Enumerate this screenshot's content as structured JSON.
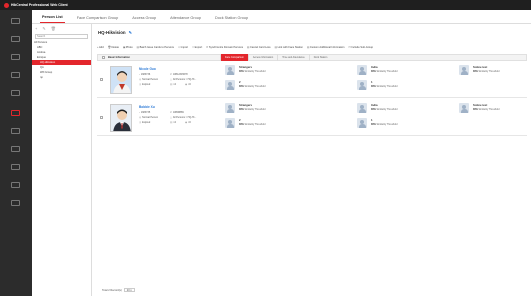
{
  "app": {
    "title": "HikCentral Professional Web Client"
  },
  "tabs": [
    "Person List",
    "Face Comparison Group",
    "Access Group",
    "Attendance Group",
    "Dock Station Group"
  ],
  "tree": {
    "search_placeholder": "Search",
    "nodes": [
      "All Persons",
      "ABC",
      "Andrea",
      "Enrique",
      "HQ-Hikvision",
      "QA",
      "Wifi Group",
      "np"
    ],
    "selected": "HQ-Hikvision"
  },
  "main": {
    "org_title": "HQ-Hikvision",
    "toolbar": [
      "Add",
      "Delete",
      "Photo",
      "Batch Issue Cards to Persons",
      "Import",
      "Export",
      "Synchronize Domain Persons",
      "Cancel Card Loss",
      "Link with Face Station",
      "Custom Additional Information",
      "Include Sub-Group"
    ],
    "header": {
      "basic": "Basic Information",
      "tabs": [
        "Face Comparison",
        "Access Information",
        "Time and Attendance",
        "Dock Station"
      ],
      "active_tab": "Face Comparison"
    }
  },
  "persons": [
    {
      "name": "Nicole Guo",
      "id": "1683736",
      "phone": "18812345678",
      "status_1": "Normal Person",
      "status_2": "Expired",
      "org": "All Persons > HQ-Hi...",
      "cards": "×4",
      "fp": "×0",
      "matches": [
        {
          "name": "Strangers",
          "score": "30%",
          "label": "Similarity Threshold",
          "count": ""
        },
        {
          "name": "",
          "score": "30%",
          "label": "Similarity Threshold",
          "count": "2"
        },
        {
          "name": "India",
          "score": "30%",
          "label": "Similarity Threshold",
          "count": ""
        },
        {
          "name": "",
          "score": "30%",
          "label": "Similarity Threshold",
          "count": "1"
        },
        {
          "name": "Sobne test",
          "score": "30%",
          "label": "Similarity Threshold",
          "count": ""
        }
      ]
    },
    {
      "name": "Bobbie Xu",
      "id": "1683735",
      "phone": "18808889",
      "status_1": "Normal Person",
      "status_2": "Expired",
      "org": "All Persons > HQ-Hi...",
      "cards": "×4",
      "fp": "×0",
      "matches": [
        {
          "name": "Strangers",
          "score": "30%",
          "label": "Similarity Threshold",
          "count": ""
        },
        {
          "name": "",
          "score": "30%",
          "label": "Similarity Threshold",
          "count": "2"
        },
        {
          "name": "India",
          "score": "30%",
          "label": "Similarity Threshold",
          "count": ""
        },
        {
          "name": "",
          "score": "30%",
          "label": "Similarity Threshold",
          "count": "1"
        },
        {
          "name": "Sobne test",
          "score": "30%",
          "label": "Similarity Threshold",
          "count": ""
        }
      ]
    }
  ],
  "pager": {
    "label": "Total 2 Record(s)",
    "per_page": "20"
  },
  "colors": {
    "accent": "#e3262c",
    "link": "#2d7ad6"
  }
}
